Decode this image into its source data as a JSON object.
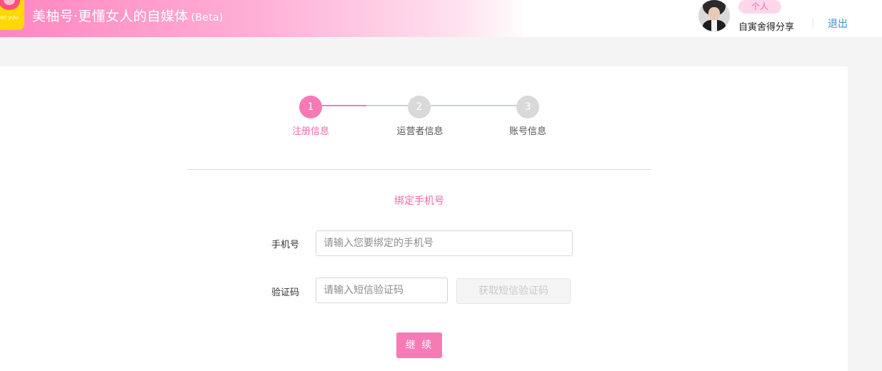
{
  "header": {
    "logo_text": "eet you",
    "site_title": "美柚号·更懂女人的自媒体",
    "beta_label": "(Beta)",
    "account_badge": "个人",
    "username": "自寅舍得分享",
    "logout_label": "退出"
  },
  "stepper": {
    "steps": [
      {
        "number": "1",
        "label": "注册信息",
        "active": true
      },
      {
        "number": "2",
        "label": "运营者信息",
        "active": false
      },
      {
        "number": "3",
        "label": "账号信息",
        "active": false
      }
    ]
  },
  "form": {
    "section_title": "绑定手机号",
    "phone_label": "手机号",
    "phone_placeholder": "请输入您要绑定的手机号",
    "phone_value": "",
    "code_label": "验证码",
    "code_placeholder": "请输入短信验证码",
    "code_value": "",
    "get_code_label": "获取短信验证码",
    "continue_label": "继 续"
  },
  "colors": {
    "accent_pink": "#f77ab4",
    "label_pink": "#f06aa8",
    "inactive_gray": "#d9d9d9",
    "link_blue": "#3a8fd6"
  }
}
